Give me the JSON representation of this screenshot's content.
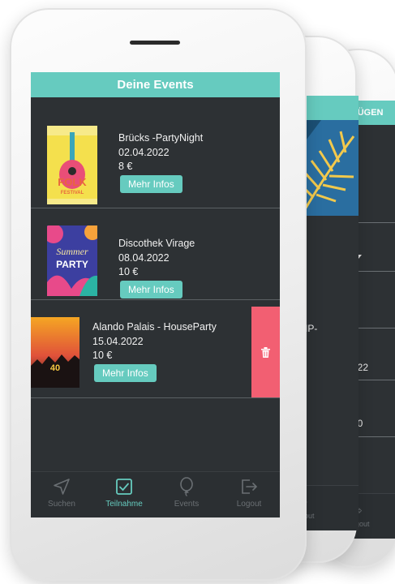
{
  "header": {
    "title": "Deine Events"
  },
  "events": [
    {
      "title": "Brücks -PartyNight",
      "date": "02.04.2022",
      "price": "8 €",
      "button": "Mehr Infos"
    },
    {
      "title": "Discothek Virage",
      "date": "08.04.2022",
      "price": "10 €",
      "button": "Mehr Infos"
    },
    {
      "title": "Alando Palais - HouseParty",
      "date": "15.04.2022",
      "price": "10 €",
      "button": "Mehr Infos"
    }
  ],
  "posters": {
    "p1_text": "FOLK",
    "p1_sub": "FESTIVAL",
    "p2_text": "Summer",
    "p2_sub": "PARTY",
    "p3_num": "40"
  },
  "nav": [
    {
      "label": "Suchen",
      "icon": "navigation-arrow-icon",
      "active": false
    },
    {
      "label": "Teilnahme",
      "icon": "checkbox-icon",
      "active": true
    },
    {
      "label": "Events",
      "icon": "balloon-icon",
      "active": false
    },
    {
      "label": "Logout",
      "icon": "logout-icon",
      "active": false
    }
  ],
  "back_phone_1": {
    "text_vip": "VIP-",
    "text_e": "e",
    "nav_label": "Logout"
  },
  "back_phone_2": {
    "header": "FÜGEN",
    "date_fragment": "022",
    "time_fragment": "00",
    "nav_label": "Logout"
  },
  "colors": {
    "accent": "#66cbbf",
    "background": "#2d3134",
    "delete": "#f25f72"
  }
}
